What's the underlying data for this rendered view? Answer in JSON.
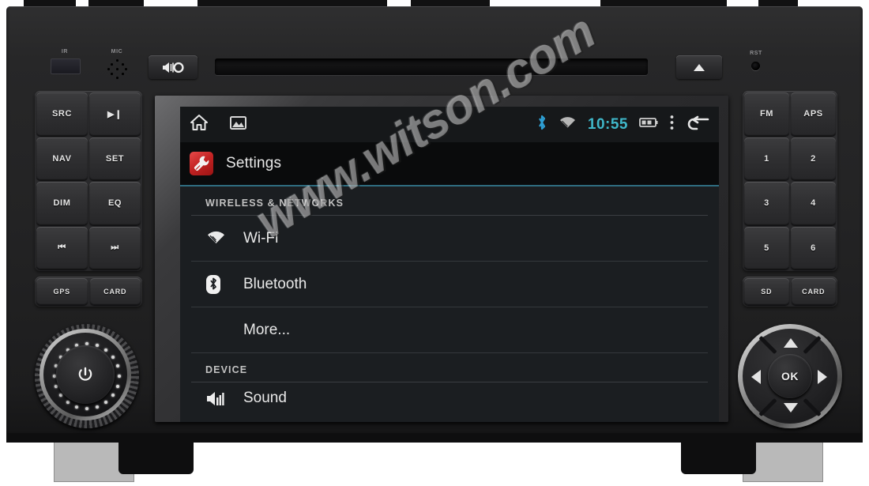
{
  "device": {
    "labels": {
      "ir": "IR",
      "mic": "MIC",
      "rst": "RST"
    },
    "left_buttons": [
      {
        "label": "SRC",
        "name": "src-button"
      },
      {
        "label": "▶❙",
        "name": "play-pause-button"
      },
      {
        "label": "NAV",
        "name": "nav-button"
      },
      {
        "label": "SET",
        "name": "set-button"
      },
      {
        "label": "DIM",
        "name": "dim-button"
      },
      {
        "label": "EQ",
        "name": "eq-button"
      },
      {
        "label": "⏮",
        "name": "previous-track-button"
      },
      {
        "label": "⏭",
        "name": "next-track-button"
      }
    ],
    "left_bottom_buttons": [
      {
        "label": "GPS",
        "name": "gps-button"
      },
      {
        "label": "CARD",
        "name": "card-button"
      }
    ],
    "right_buttons": [
      {
        "label": "FM",
        "name": "fm-button"
      },
      {
        "label": "APS",
        "name": "aps-button"
      },
      {
        "label": "1",
        "name": "preset-1-button"
      },
      {
        "label": "2",
        "name": "preset-2-button"
      },
      {
        "label": "3",
        "name": "preset-3-button"
      },
      {
        "label": "4",
        "name": "preset-4-button"
      },
      {
        "label": "5",
        "name": "preset-5-button"
      },
      {
        "label": "6",
        "name": "preset-6-button"
      }
    ],
    "right_bottom_buttons": [
      {
        "label": "SD",
        "name": "sd-button"
      },
      {
        "label": "CARD",
        "name": "card-slot-button"
      }
    ],
    "dpad": {
      "ok_label": "OK"
    }
  },
  "screen": {
    "statusbar": {
      "home_icon": "home-icon",
      "gallery_icon": "gallery-icon",
      "bluetooth_icon": "bluetooth-icon",
      "wifi_icon": "wifi-icon",
      "time": "10:55",
      "battery_icon": "battery-icon",
      "overflow_icon": "overflow-menu-icon",
      "back_icon": "back-arrow-icon",
      "time_color": "#3fb7c9",
      "bluetooth_color": "#2e9fd4"
    },
    "title": {
      "text": "Settings",
      "icon": "settings-wrench-icon",
      "icon_color": "#c12222",
      "underline_color": "#2f6d80"
    },
    "sections": [
      {
        "header": "WIRELESS & NETWORKS",
        "items": [
          {
            "label": "Wi-Fi",
            "icon": "wifi-icon"
          },
          {
            "label": "Bluetooth",
            "icon": "bluetooth-icon"
          },
          {
            "label": "More...",
            "icon": ""
          }
        ]
      },
      {
        "header": "DEVICE",
        "items": [
          {
            "label": "Sound",
            "icon": "sound-icon"
          }
        ]
      }
    ]
  },
  "watermark": {
    "text": "www.witson.com"
  }
}
